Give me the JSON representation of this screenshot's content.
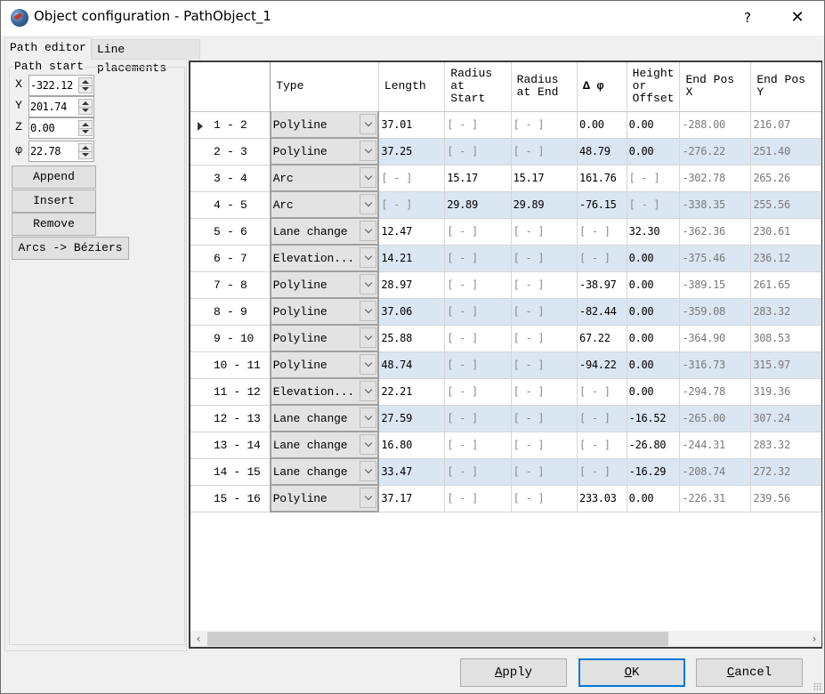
{
  "window": {
    "title": "Object configuration - PathObject_1",
    "help_label": "?",
    "close_label": "✕"
  },
  "tabs": [
    {
      "label": "Path editor",
      "active": true
    },
    {
      "label": "Line placements",
      "active": false
    }
  ],
  "path_start": {
    "group_title": "Path start",
    "fields": [
      {
        "label": "X",
        "value": "-322.12"
      },
      {
        "label": "Y",
        "value": "201.74"
      },
      {
        "label": "Z",
        "value": "0.00"
      },
      {
        "label": "φ",
        "value": "22.78"
      }
    ],
    "buttons": {
      "append": "Append",
      "insert": "Insert",
      "remove": "Remove",
      "arcs_to_beziers": "Arcs -> Béziers"
    }
  },
  "table": {
    "columns": [
      "",
      "Type",
      "Length",
      "Radius\nat Start",
      "Radius\nat End",
      "Δ φ",
      "Height\nor\nOffset",
      "End Pos X",
      "End Pos Y"
    ],
    "selected_row": 0,
    "rows": [
      {
        "segment": "1 - 2",
        "type": "Polyline",
        "length": "37.01",
        "radius_start": "[ - ]",
        "radius_end": "[ - ]",
        "delta_phi": "0.00",
        "height_offset": "0.00",
        "end_x": "-288.00",
        "end_y": "216.07"
      },
      {
        "segment": "2 - 3",
        "type": "Polyline",
        "length": "37.25",
        "radius_start": "[ - ]",
        "radius_end": "[ - ]",
        "delta_phi": "48.79",
        "height_offset": "0.00",
        "end_x": "-276.22",
        "end_y": "251.40"
      },
      {
        "segment": "3 - 4",
        "type": "Arc",
        "length": "[ - ]",
        "radius_start": "15.17",
        "radius_end": "15.17",
        "delta_phi": "161.76",
        "height_offset": "[ - ]",
        "end_x": "-302.78",
        "end_y": "265.26"
      },
      {
        "segment": "4 - 5",
        "type": "Arc",
        "length": "[ - ]",
        "radius_start": "29.89",
        "radius_end": "29.89",
        "delta_phi": "-76.15",
        "height_offset": "[ - ]",
        "end_x": "-338.35",
        "end_y": "255.56"
      },
      {
        "segment": "5 - 6",
        "type": "Lane change",
        "length": "12.47",
        "radius_start": "[ - ]",
        "radius_end": "[ - ]",
        "delta_phi": "[ - ]",
        "height_offset": "32.30",
        "end_x": "-362.36",
        "end_y": "230.61"
      },
      {
        "segment": "6 - 7",
        "type": "Elevation...",
        "length": "14.21",
        "radius_start": "[ - ]",
        "radius_end": "[ - ]",
        "delta_phi": "[ - ]",
        "height_offset": "0.00",
        "end_x": "-375.46",
        "end_y": "236.12"
      },
      {
        "segment": "7 - 8",
        "type": "Polyline",
        "length": "28.97",
        "radius_start": "[ - ]",
        "radius_end": "[ - ]",
        "delta_phi": "-38.97",
        "height_offset": "0.00",
        "end_x": "-389.15",
        "end_y": "261.65"
      },
      {
        "segment": "8 - 9",
        "type": "Polyline",
        "length": "37.06",
        "radius_start": "[ - ]",
        "radius_end": "[ - ]",
        "delta_phi": "-82.44",
        "height_offset": "0.00",
        "end_x": "-359.08",
        "end_y": "283.32"
      },
      {
        "segment": "9 - 10",
        "type": "Polyline",
        "length": "25.88",
        "radius_start": "[ - ]",
        "radius_end": "[ - ]",
        "delta_phi": "67.22",
        "height_offset": "0.00",
        "end_x": "-364.90",
        "end_y": "308.53"
      },
      {
        "segment": "10 - 11",
        "type": "Polyline",
        "length": "48.74",
        "radius_start": "[ - ]",
        "radius_end": "[ - ]",
        "delta_phi": "-94.22",
        "height_offset": "0.00",
        "end_x": "-316.73",
        "end_y": "315.97"
      },
      {
        "segment": "11 - 12",
        "type": "Elevation...",
        "length": "22.21",
        "radius_start": "[ - ]",
        "radius_end": "[ - ]",
        "delta_phi": "[ - ]",
        "height_offset": "0.00",
        "end_x": "-294.78",
        "end_y": "319.36"
      },
      {
        "segment": "12 - 13",
        "type": "Lane change",
        "length": "27.59",
        "radius_start": "[ - ]",
        "radius_end": "[ - ]",
        "delta_phi": "[ - ]",
        "height_offset": "-16.52",
        "end_x": "-265.00",
        "end_y": "307.24"
      },
      {
        "segment": "13 - 14",
        "type": "Lane change",
        "length": "16.80",
        "radius_start": "[ - ]",
        "radius_end": "[ - ]",
        "delta_phi": "[ - ]",
        "height_offset": "-26.80",
        "end_x": "-244.31",
        "end_y": "283.32"
      },
      {
        "segment": "14 - 15",
        "type": "Lane change",
        "length": "33.47",
        "radius_start": "[ - ]",
        "radius_end": "[ - ]",
        "delta_phi": "[ - ]",
        "height_offset": "-16.29",
        "end_x": "-208.74",
        "end_y": "272.32"
      },
      {
        "segment": "15 - 16",
        "type": "Polyline",
        "length": "37.17",
        "radius_start": "[ - ]",
        "radius_end": "[ - ]",
        "delta_phi": "233.03",
        "height_offset": "0.00",
        "end_x": "-226.31",
        "end_y": "239.56"
      }
    ]
  },
  "scrollbar": {
    "left_arrow": "‹",
    "right_arrow": "›"
  },
  "dialog_buttons": {
    "apply": {
      "label": "Apply",
      "mnemonic": "A"
    },
    "ok": {
      "label": "OK",
      "mnemonic": "O"
    },
    "cancel": {
      "label": "Cancel",
      "mnemonic": "C"
    }
  },
  "colors": {
    "alt_row": "#dae6f2",
    "default_button_border": "#0078d7",
    "readonly_text": "#7a7a7a"
  }
}
